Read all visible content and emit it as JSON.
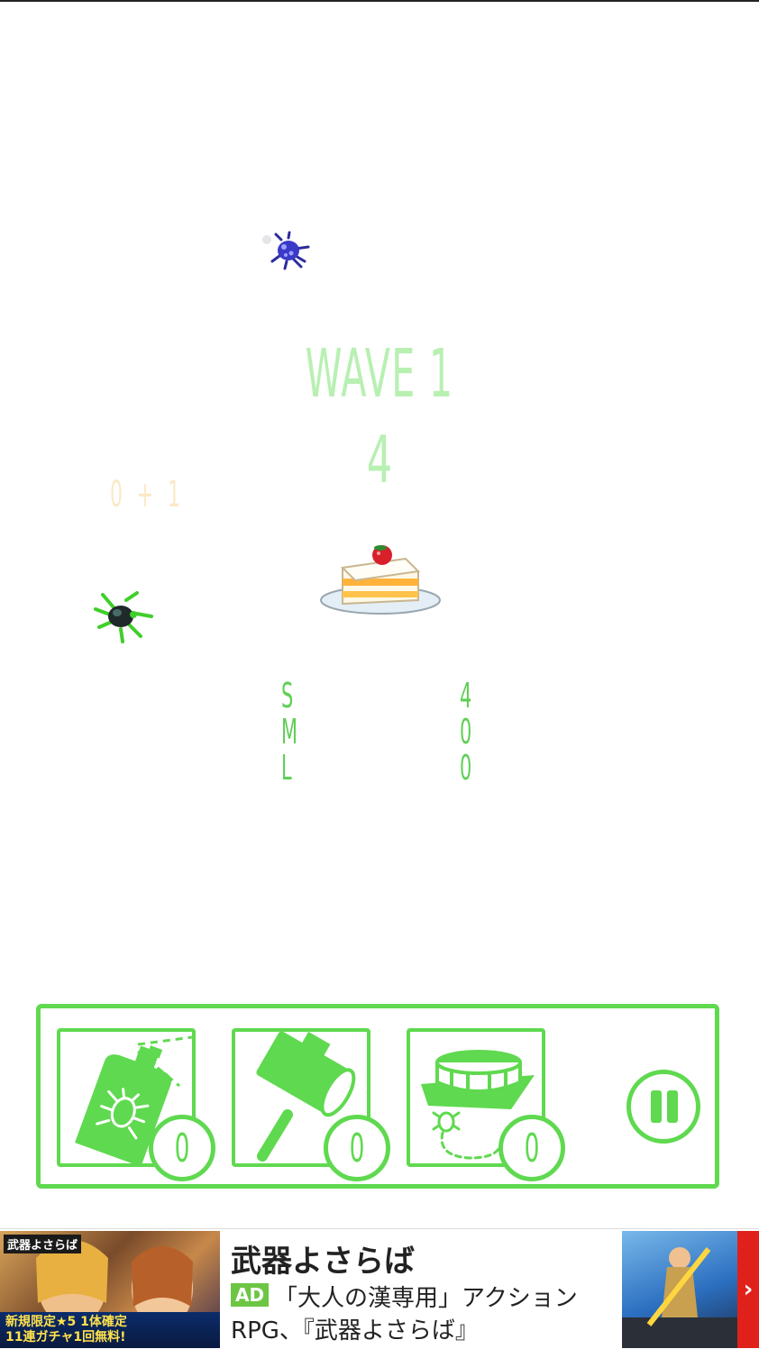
{
  "wave": {
    "title": "WAVE 1",
    "countdown": "4"
  },
  "faded_score": "0 + 1",
  "stats": [
    {
      "label": "S",
      "value": "4"
    },
    {
      "label": "M",
      "value": "0"
    },
    {
      "label": "L",
      "value": "0"
    }
  ],
  "tools": [
    {
      "name": "bug-spray",
      "icon": "spray-can-icon",
      "count": "0"
    },
    {
      "name": "hammer",
      "icon": "hammer-icon",
      "count": "0"
    },
    {
      "name": "trap",
      "icon": "bug-trap-icon",
      "count": "0"
    }
  ],
  "pause_icon": "pause-icon",
  "colors": {
    "accent": "#5fd94f",
    "wave_text": "#b8f0b2",
    "stat_text": "#5fcf55"
  },
  "ad": {
    "title": "武器よさらば",
    "badge": "AD",
    "line1": "「大人の漢専用」アクション",
    "line2": "RPG、『武器よさらば』",
    "image_tag": "武器よさらば",
    "image_banner_line1": "新規限定★5 1体確定",
    "image_banner_line2": "11連ガチャ1回無料!",
    "arrow": "›"
  }
}
